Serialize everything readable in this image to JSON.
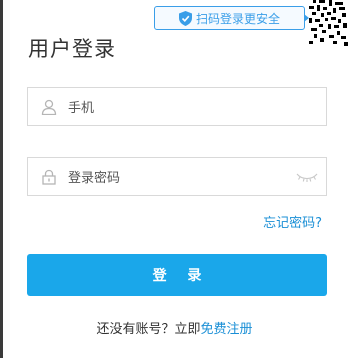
{
  "qr_tip": {
    "label": "扫码登录更安全"
  },
  "title": "用户登录",
  "phone_field": {
    "placeholder": "手机"
  },
  "password_field": {
    "placeholder": "登录密码"
  },
  "forgot_link": "忘记密码?",
  "login_button": "登 录",
  "signup": {
    "prompt": "还没有账号？立即",
    "link": "免费注册"
  },
  "colors": {
    "accent": "#1aa7ea",
    "link": "#1a8fd6",
    "tip_border": "#3a9ee8"
  },
  "icons": [
    "shield-check-icon",
    "qr-code-icon",
    "user-icon",
    "lock-icon",
    "eye-closed-icon"
  ]
}
